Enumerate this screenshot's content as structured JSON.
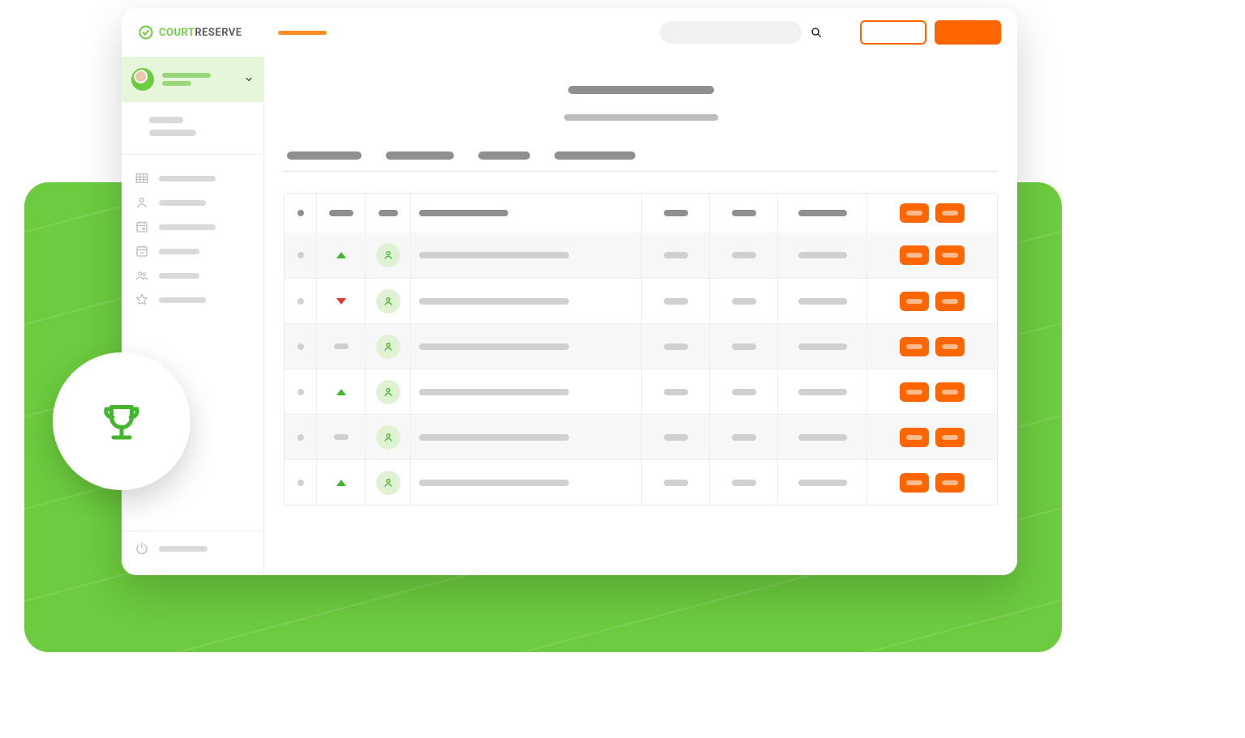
{
  "brand": {
    "part1": "COURT",
    "part2": "RESERVE"
  },
  "topbar": {
    "search_placeholder": "",
    "outline_button_label": "",
    "solid_button_label": ""
  },
  "sidebar": {
    "user": {
      "name": "",
      "subtitle": ""
    },
    "heading1": "",
    "heading2": "",
    "items": [
      {
        "icon": "grid-icon",
        "label": ""
      },
      {
        "icon": "person-icon",
        "label": ""
      },
      {
        "icon": "calendar-event-icon",
        "label": ""
      },
      {
        "icon": "calendar-minus-icon",
        "label": ""
      },
      {
        "icon": "group-icon",
        "label": ""
      },
      {
        "icon": "star-icon",
        "label": ""
      }
    ],
    "footer_label": ""
  },
  "page": {
    "title": "",
    "subtitle": ""
  },
  "tabs": [
    {
      "label": ""
    },
    {
      "label": ""
    },
    {
      "label": ""
    },
    {
      "label": ""
    }
  ],
  "table": {
    "columns": [
      {
        "key": "status",
        "label": ""
      },
      {
        "key": "rank",
        "label": ""
      },
      {
        "key": "trend",
        "label": ""
      },
      {
        "key": "name",
        "label": ""
      },
      {
        "key": "c1",
        "label": ""
      },
      {
        "key": "c2",
        "label": ""
      },
      {
        "key": "c3",
        "label": ""
      },
      {
        "key": "actions",
        "label": ""
      }
    ],
    "rows": [
      {
        "trend": "up",
        "name": "",
        "c1": "",
        "c2": "",
        "c3": ""
      },
      {
        "trend": "down",
        "name": "",
        "c1": "",
        "c2": "",
        "c3": ""
      },
      {
        "trend": "flat",
        "name": "",
        "c1": "",
        "c2": "",
        "c3": ""
      },
      {
        "trend": "up",
        "name": "",
        "c1": "",
        "c2": "",
        "c3": ""
      },
      {
        "trend": "flat",
        "name": "",
        "c1": "",
        "c2": "",
        "c3": ""
      },
      {
        "trend": "up",
        "name": "",
        "c1": "",
        "c2": "",
        "c3": ""
      }
    ]
  },
  "colors": {
    "green": "#6CCB3E",
    "orange": "#FF6600",
    "orange_soft": "#FF8B24",
    "red": "#E53935",
    "gray": "#BDBDBD"
  }
}
